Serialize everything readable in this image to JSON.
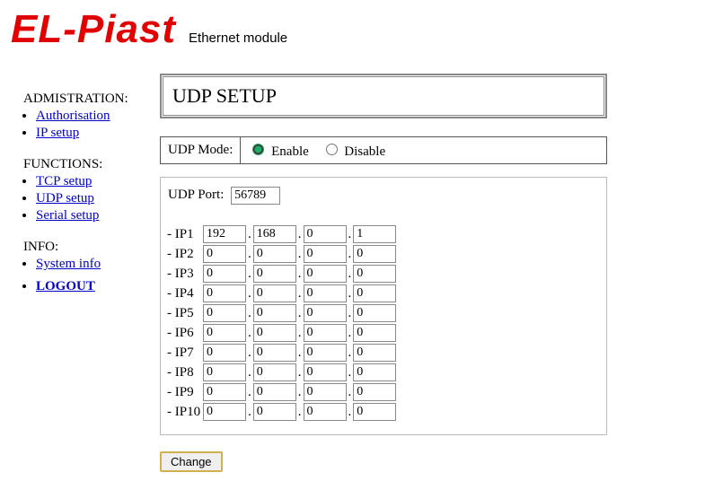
{
  "header": {
    "brand": "EL-Piast",
    "subtitle": "Ethernet module"
  },
  "sidebar": {
    "sections": [
      {
        "label": "ADMISTRATION:",
        "items": [
          {
            "label": " Authorisation"
          },
          {
            "label": " IP setup"
          }
        ]
      },
      {
        "label": "FUNCTIONS:",
        "items": [
          {
            "label": " TCP setup"
          },
          {
            "label": " UDP setup"
          },
          {
            "label": " Serial setup"
          }
        ]
      },
      {
        "label": "INFO:",
        "items": [
          {
            "label": " System info"
          }
        ]
      }
    ],
    "logout": "LOGOUT"
  },
  "main": {
    "title": "UDP SETUP",
    "mode_label": "UDP Mode:",
    "mode_enable": "Enable",
    "mode_disable": "Disable",
    "mode_value": "enable",
    "port_label": "UDP Port:",
    "port_value": "56789",
    "ip_rows": [
      {
        "label": "- IP1",
        "o1": "192",
        "o2": "168",
        "o3": "0",
        "o4": "1"
      },
      {
        "label": "- IP2",
        "o1": "0",
        "o2": "0",
        "o3": "0",
        "o4": "0"
      },
      {
        "label": "- IP3",
        "o1": "0",
        "o2": "0",
        "o3": "0",
        "o4": "0"
      },
      {
        "label": "- IP4",
        "o1": "0",
        "o2": "0",
        "o3": "0",
        "o4": "0"
      },
      {
        "label": "- IP5",
        "o1": "0",
        "o2": "0",
        "o3": "0",
        "o4": "0"
      },
      {
        "label": "- IP6",
        "o1": "0",
        "o2": "0",
        "o3": "0",
        "o4": "0"
      },
      {
        "label": "- IP7",
        "o1": "0",
        "o2": "0",
        "o3": "0",
        "o4": "0"
      },
      {
        "label": "- IP8",
        "o1": "0",
        "o2": "0",
        "o3": "0",
        "o4": "0"
      },
      {
        "label": "- IP9",
        "o1": "0",
        "o2": "0",
        "o3": "0",
        "o4": "0"
      },
      {
        "label": "- IP10",
        "o1": "0",
        "o2": "0",
        "o3": "0",
        "o4": "0"
      }
    ],
    "change_label": "Change"
  }
}
